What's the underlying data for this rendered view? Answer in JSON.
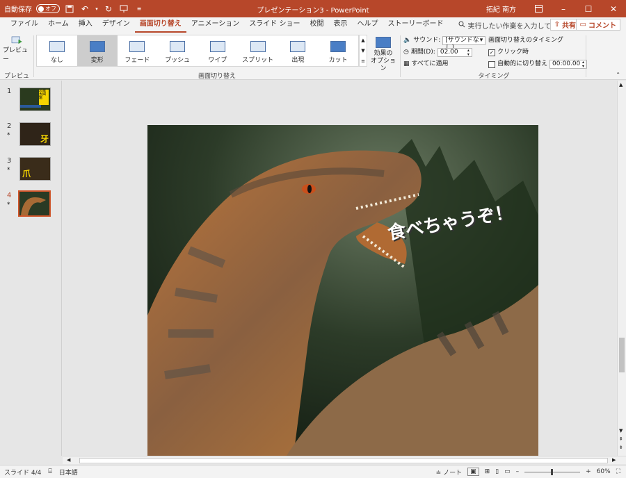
{
  "titlebar": {
    "autosave_label": "自動保存",
    "autosave_state": "オフ",
    "title": "プレゼンテーション3 - PowerPoint",
    "user": "拓紀 南方",
    "bg_color": "#b7472a"
  },
  "menu": {
    "tabs": [
      "ファイル",
      "ホーム",
      "挿入",
      "デザイン",
      "画面切り替え",
      "アニメーション",
      "スライド ショー",
      "校閲",
      "表示",
      "ヘルプ",
      "ストーリーボード"
    ],
    "active_tab": "画面切り替え",
    "tell_me": "実行したい作業を入力してください",
    "share": "共有",
    "comment": "コメント"
  },
  "ribbon": {
    "preview_button": "プレビュー",
    "preview_group": "プレビュー",
    "transitions_group": "画面切り替え",
    "transitions": [
      "なし",
      "変形",
      "フェード",
      "プッシュ",
      "ワイプ",
      "スプリット",
      "出現",
      "カット"
    ],
    "selected_transition": "変形",
    "effect_options_line1": "効果の",
    "effect_options_line2": "オプション",
    "timing_group": "タイミング",
    "sound_label": "サウンド:",
    "sound_value": "[サウンドなし]",
    "duration_label": "期間(D):",
    "duration_value": "02.00",
    "apply_all": "すべてに適用",
    "advance_label": "画面切り替えのタイミング",
    "on_click": "クリック時",
    "on_click_checked": true,
    "after_label": "自動的に切り替え",
    "after_checked": false,
    "after_value": "00:00.00"
  },
  "slides": [
    {
      "num": "1",
      "star": "",
      "thumb_text": "恐竜大図鑑"
    },
    {
      "num": "2",
      "star": "*",
      "thumb_text": "牙"
    },
    {
      "num": "3",
      "star": "*",
      "thumb_text": "爪"
    },
    {
      "num": "4",
      "star": "*",
      "thumb_text": ""
    }
  ],
  "active_slide": 4,
  "slide_content": {
    "caption": "食べちゃうぞ！"
  },
  "status": {
    "slide_info": "スライド 4/4",
    "language": "日本語",
    "notes": "ノート",
    "zoom": "60%"
  }
}
